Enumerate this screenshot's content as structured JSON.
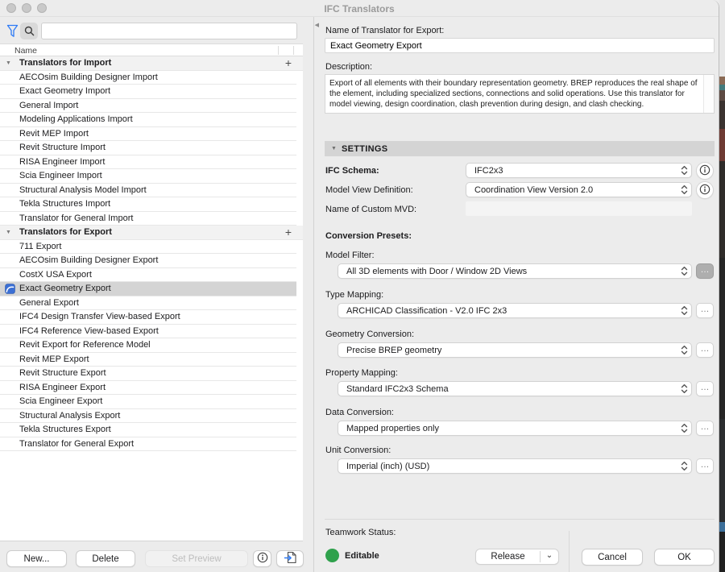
{
  "icons": {
    "disclosure_down": "▼",
    "collapse_left": "◀",
    "plus": "+",
    "ellipsis": "…",
    "release_chevron": "⌄"
  },
  "window": {
    "title": "IFC Translators"
  },
  "left_panel": {
    "search": {
      "value": "",
      "placeholder": ""
    },
    "column_header": "Name",
    "groups": [
      {
        "label": "Translators for Import",
        "items": [
          {
            "label": "AECOsim Building Designer Import"
          },
          {
            "label": "Exact Geometry Import"
          },
          {
            "label": "General Import"
          },
          {
            "label": "Modeling Applications Import"
          },
          {
            "label": "Revit MEP Import"
          },
          {
            "label": "Revit Structure Import"
          },
          {
            "label": "RISA Engineer Import"
          },
          {
            "label": "Scia Engineer Import"
          },
          {
            "label": "Structural Analysis Model Import"
          },
          {
            "label": "Tekla Structures Import"
          },
          {
            "label": "Translator for General Import"
          }
        ]
      },
      {
        "label": "Translators for Export",
        "items": [
          {
            "label": "711 Export"
          },
          {
            "label": "AECOsim Building Designer Export"
          },
          {
            "label": "CostX USA Export"
          },
          {
            "label": "Exact Geometry Export",
            "selected": true,
            "icon": true
          },
          {
            "label": "General Export"
          },
          {
            "label": "IFC4 Design Transfer View-based Export"
          },
          {
            "label": "IFC4 Reference View-based Export"
          },
          {
            "label": "Revit Export for Reference Model"
          },
          {
            "label": "Revit MEP Export"
          },
          {
            "label": "Revit Structure Export"
          },
          {
            "label": "RISA Engineer Export"
          },
          {
            "label": "Scia Engineer Export"
          },
          {
            "label": "Structural Analysis Export"
          },
          {
            "label": "Tekla Structures Export"
          },
          {
            "label": "Translator for General Export"
          }
        ]
      }
    ],
    "footer": {
      "new": "New...",
      "delete": "Delete",
      "set_preview": "Set Preview"
    }
  },
  "right_panel": {
    "name_label": "Name of Translator for Export:",
    "name_value": "Exact Geometry Export",
    "description_label": "Description:",
    "description_value": "Export of all elements with their boundary representation geometry. BREP reproduces the real shape of the element, including specialized sections, connections and solid operations. Use this translator for model viewing, design coordination, clash prevention during design, and clash checking.",
    "settings_header": "SETTINGS",
    "fields": {
      "ifc_schema_label": "IFC Schema:",
      "ifc_schema_value": "IFC2x3",
      "mvd_label": "Model View Definition:",
      "mvd_value": "Coordination View Version 2.0",
      "custom_mvd_label": "Name of Custom MVD:",
      "custom_mvd_value": ""
    },
    "conversion_presets_label": "Conversion Presets:",
    "presets": [
      {
        "label": "Model Filter:",
        "value": "All 3D elements with Door / Window 2D Views"
      },
      {
        "label": "Type Mapping:",
        "value": "ARCHICAD Classification - V2.0 IFC 2x3"
      },
      {
        "label": "Geometry Conversion:",
        "value": "Precise BREP geometry"
      },
      {
        "label": "Property Mapping:",
        "value": "Standard IFC2x3 Schema"
      },
      {
        "label": "Data Conversion:",
        "value": "Mapped properties only"
      },
      {
        "label": "Unit Conversion:",
        "value": "Imperial (inch) (USD)"
      }
    ],
    "teamwork": {
      "label": "Teamwork Status:",
      "status": "Editable",
      "status_color": "#2FA14C",
      "release": "Release"
    },
    "cancel": "Cancel",
    "ok": "OK"
  }
}
